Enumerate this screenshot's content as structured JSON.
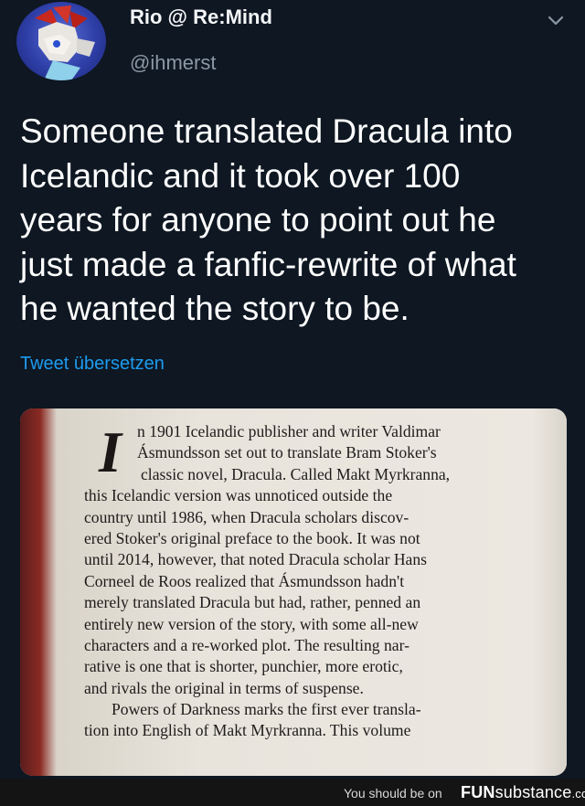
{
  "tweet": {
    "display_name": "Rio @ Re:Mind",
    "handle": "@ihmerst",
    "text_lines": [
      "Someone translated Dracula into",
      "Icelandic and it took over 100",
      "years for anyone to point out he",
      "just made a fanfic-rewrite of what",
      "he wanted the story to be."
    ],
    "translate_link": "Tweet übersetzen"
  },
  "book_page": {
    "drop_cap": "I",
    "lines": [
      "n 1901 Icelandic publisher and writer Valdimar",
      "Ásmundsson set out to translate Bram Stoker's",
      "classic novel, Dracula. Called Makt Myrkranna,",
      "this Icelandic version was unnoticed outside the",
      "country until 1986, when Dracula scholars discov-",
      "ered Stoker's original preface to the book. It was not",
      "until 2014, however, that noted Dracula scholar Hans",
      "Corneel de Roos realized that Ásmundsson hadn't",
      "merely translated Dracula but had, rather, penned an",
      "entirely new version of the story, with some all-new",
      "characters and a re-worked plot. The resulting nar-",
      "rative is one that is shorter, punchier, more erotic,",
      "and rivals the original in terms of suspense.",
      "Powers of Darkness marks the first ever transla-",
      "tion into English of Makt Myrkranna. This volume"
    ]
  },
  "footer": {
    "prefix": "You should be on",
    "brand_bold": "FUN",
    "brand_rest": "substance",
    "brand_suffix": ".com"
  },
  "colors": {
    "background": "#0e1722",
    "link": "#1d9bf0",
    "handle": "#8b98a5"
  }
}
